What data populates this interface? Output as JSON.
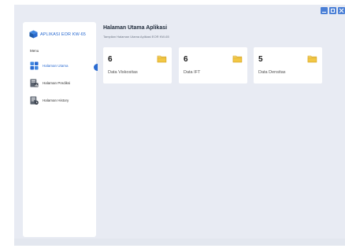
{
  "app": {
    "name": "APLIKASI EOR KW-65"
  },
  "window_controls": [
    "minimize-icon",
    "maximize-icon",
    "close-icon"
  ],
  "sidebar": {
    "menu_label": "Menu",
    "items": [
      {
        "label": "Halaman Utama",
        "icon": "dashboard-icon",
        "active": true
      },
      {
        "label": "Halaman Prediksi",
        "icon": "chart-document-icon",
        "active": false
      },
      {
        "label": "Halaman History",
        "icon": "history-document-icon",
        "active": false
      }
    ]
  },
  "main": {
    "title": "Halaman Utama Aplikasi",
    "subtitle": "Tampilan Halaman Utama Aplikasi EOR KW-65",
    "cards": [
      {
        "count": "6",
        "label": "Data Viskositas",
        "icon": "folder-icon"
      },
      {
        "count": "6",
        "label": "Data IFT",
        "icon": "folder-icon"
      },
      {
        "count": "5",
        "label": "Data Densitas",
        "icon": "folder-icon"
      }
    ]
  },
  "colors": {
    "accent": "#2a6bd1",
    "background": "#e8ebf3",
    "card": "#ffffff",
    "folder": "#f2c744"
  }
}
